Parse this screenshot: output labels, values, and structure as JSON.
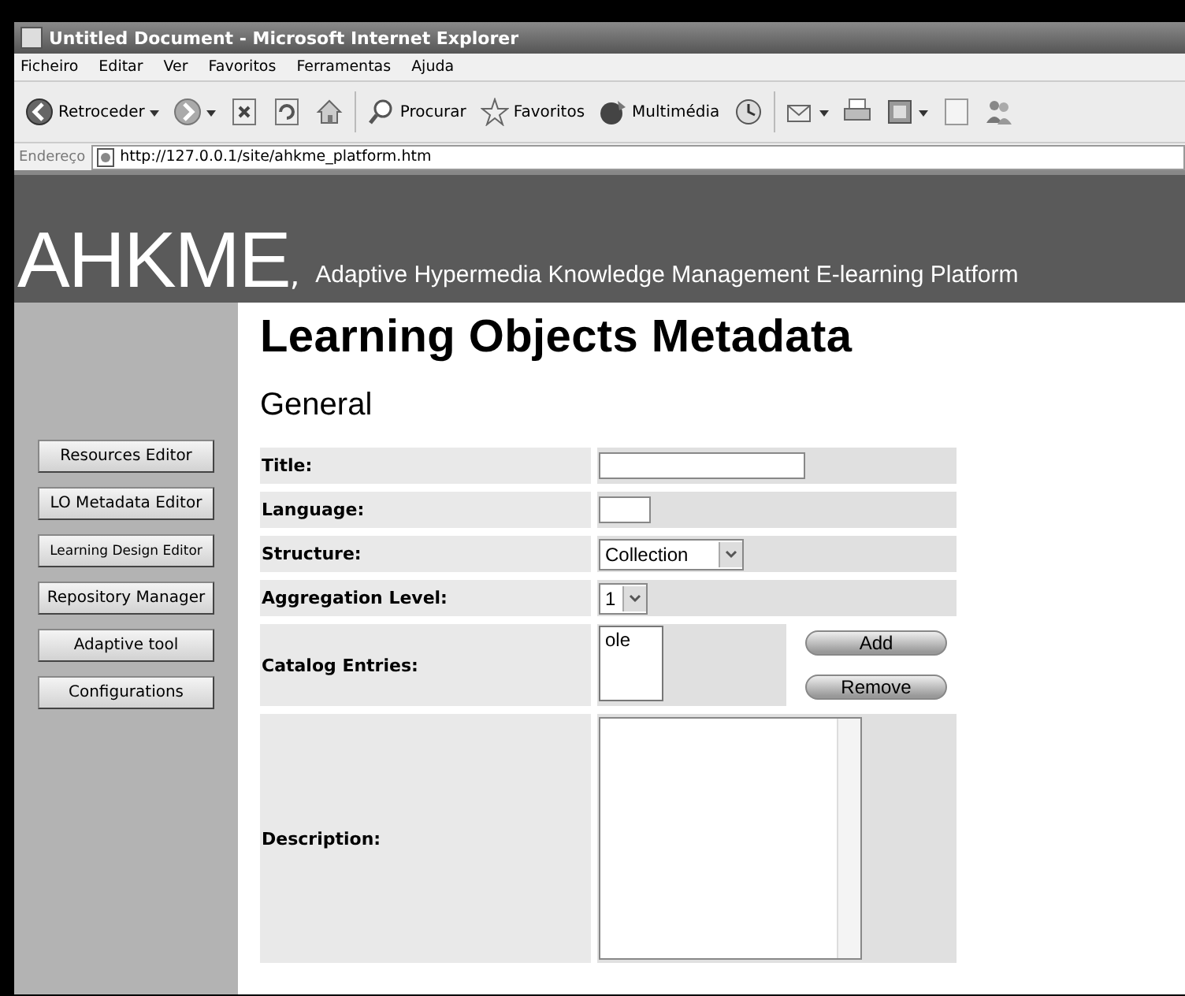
{
  "window": {
    "title": "Untitled Document - Microsoft Internet Explorer"
  },
  "menu": [
    "Ficheiro",
    "Editar",
    "Ver",
    "Favoritos",
    "Ferramentas",
    "Ajuda"
  ],
  "toolbar": [
    {
      "kind": "back",
      "label": "Retroceder"
    },
    {
      "kind": "forward"
    },
    {
      "kind": "stop"
    },
    {
      "kind": "refresh"
    },
    {
      "kind": "home"
    },
    {
      "kind": "search",
      "label": "Procurar"
    },
    {
      "kind": "favorites",
      "label": "Favoritos"
    },
    {
      "kind": "media",
      "label": "Multimédia"
    },
    {
      "kind": "history"
    },
    {
      "kind": "mail"
    },
    {
      "kind": "print"
    },
    {
      "kind": "edit"
    },
    {
      "kind": "discuss"
    },
    {
      "kind": "messenger"
    }
  ],
  "address": {
    "label": "Endereço",
    "value": "http://127.0.0.1/site/ahkme_platform.htm"
  },
  "banner": {
    "logo": "AHKME",
    "separator": ",",
    "tagline": "Adaptive Hypermedia Knowledge Management E-learning Platform"
  },
  "nav": [
    "Resources Editor",
    "LO Metadata Editor",
    "Learning Design Editor",
    "Repository Manager",
    "Adaptive tool",
    "Configurations"
  ],
  "page": {
    "heading": "Learning Objects Metadata",
    "section": "General"
  },
  "fields": [
    {
      "kind": "text",
      "label": "Title:"
    },
    {
      "kind": "short",
      "label": "Language:"
    },
    {
      "kind": "select",
      "label": "Structure:",
      "value": "Collection"
    },
    {
      "kind": "select-small",
      "label": "Aggregation Level:",
      "value": "1"
    },
    {
      "kind": "list",
      "label": "Catalog Entries:",
      "items": [
        "ole"
      ],
      "buttons": [
        "Add",
        "Remove"
      ]
    },
    {
      "kind": "textarea",
      "label": "Description:"
    }
  ]
}
